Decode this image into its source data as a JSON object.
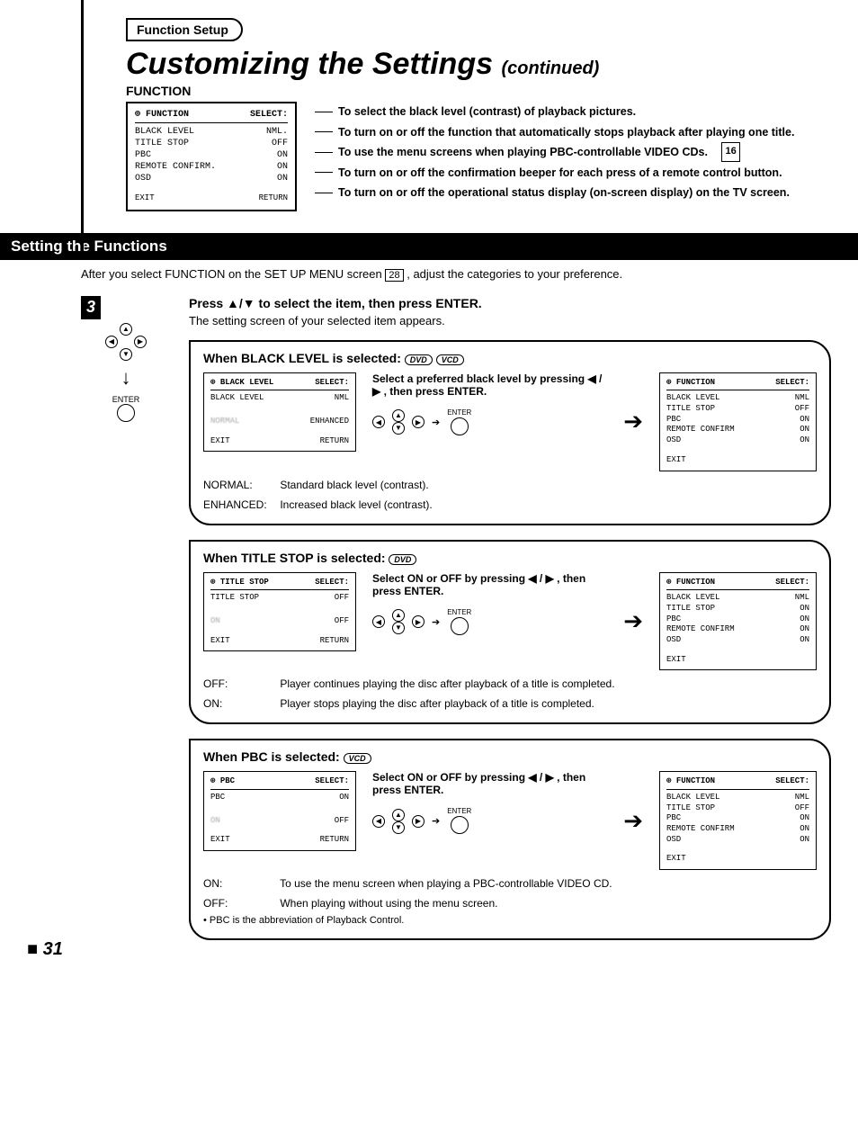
{
  "header": {
    "tab": "Function Setup",
    "title": "Customizing the Settings",
    "continued": "(continued)",
    "subhead": "FUNCTION"
  },
  "top_osd": {
    "title": "FUNCTION",
    "select": "SELECT:",
    "rows": [
      {
        "k": "BLACK LEVEL",
        "v": "NML."
      },
      {
        "k": "TITLE STOP",
        "v": "OFF"
      },
      {
        "k": "PBC",
        "v": "ON"
      },
      {
        "k": "REMOTE CONFIRM.",
        "v": "ON"
      },
      {
        "k": "OSD",
        "v": "ON"
      }
    ],
    "exit": "EXIT",
    "return": "RETURN"
  },
  "descriptions": [
    "To select the black level (contrast) of playback pictures.",
    "To turn on or off the function that automatically stops playback after playing one title.",
    "To use the menu screens when playing PBC-controllable VIDEO CDs.",
    "To turn on or off the confirmation beeper for each press of a remote control button.",
    "To turn on or off the operational status display (on-screen display) on the TV screen."
  ],
  "desc_ref": "16",
  "section_bar": "Setting the Functions",
  "intro_a": "After you select FUNCTION on the SET UP MENU screen ",
  "intro_ref": "28",
  "intro_b": " , adjust the categories to your preference.",
  "step": {
    "num": "3",
    "title": "Press ▲/▼ to select the item, then press ENTER.",
    "sub": "The setting screen of your selected item appears.",
    "enter_label": "ENTER"
  },
  "panels": [
    {
      "title": "When BLACK LEVEL is selected:",
      "badges": [
        "DVD",
        "VCD"
      ],
      "left_osd": {
        "title": "BLACK LEVEL",
        "select": "SELECT:",
        "rows": [
          {
            "k": "BLACK LEVEL",
            "v": "NML"
          }
        ],
        "opt1": "NORMAL",
        "opt2": "ENHANCED",
        "exit": "EXIT",
        "return": "RETURN"
      },
      "mid_text": "Select a preferred black level by pressing ◀ / ▶ , then press ENTER.",
      "enter_lbl": "ENTER",
      "result_osd": {
        "title": "FUNCTION",
        "select": "SELECT:",
        "rows": [
          {
            "k": "BLACK LEVEL",
            "v": "NML"
          },
          {
            "k": "TITLE STOP",
            "v": "OFF"
          },
          {
            "k": "PBC",
            "v": "ON"
          },
          {
            "k": "REMOTE CONFIRM",
            "v": "ON"
          },
          {
            "k": "OSD",
            "v": "ON"
          }
        ],
        "exit": "EXIT",
        "return": ""
      },
      "defs": [
        {
          "lbl": "NORMAL:",
          "txt": "Standard black level (contrast)."
        },
        {
          "lbl": "ENHANCED:",
          "txt": "Increased black level (contrast)."
        }
      ]
    },
    {
      "title": "When TITLE STOP is selected:",
      "badges": [
        "DVD"
      ],
      "left_osd": {
        "title": "TITLE STOP",
        "select": "SELECT:",
        "rows": [
          {
            "k": "TITLE STOP",
            "v": "OFF"
          }
        ],
        "opt1": "ON",
        "opt2": "OFF",
        "exit": "EXIT",
        "return": "RETURN"
      },
      "mid_text": "Select ON or OFF by pressing ◀ / ▶ , then press ENTER.",
      "enter_lbl": "ENTER",
      "result_osd": {
        "title": "FUNCTION",
        "select": "SELECT:",
        "rows": [
          {
            "k": "BLACK LEVEL",
            "v": "NML"
          },
          {
            "k": "TITLE STOP",
            "v": "ON"
          },
          {
            "k": "PBC",
            "v": "ON"
          },
          {
            "k": "REMOTE CONFIRM",
            "v": "ON"
          },
          {
            "k": "OSD",
            "v": "ON"
          }
        ],
        "exit": "EXIT",
        "return": ""
      },
      "defs": [
        {
          "lbl": "OFF:",
          "txt": "Player continues playing the disc after playback of a title is completed."
        },
        {
          "lbl": "ON:",
          "txt": "Player stops playing the disc after playback of a title is completed."
        }
      ]
    },
    {
      "title": "When PBC is selected:",
      "badges": [
        "VCD"
      ],
      "left_osd": {
        "title": "PBC",
        "select": "SELECT:",
        "rows": [
          {
            "k": "PBC",
            "v": "ON"
          }
        ],
        "opt1": "ON",
        "opt2": "OFF",
        "exit": "EXIT",
        "return": "RETURN"
      },
      "mid_text": "Select ON or OFF by pressing ◀ / ▶ , then press ENTER.",
      "enter_lbl": "ENTER",
      "result_osd": {
        "title": "FUNCTION",
        "select": "SELECT:",
        "rows": [
          {
            "k": "BLACK LEVEL",
            "v": "NML"
          },
          {
            "k": "TITLE STOP",
            "v": "OFF"
          },
          {
            "k": "PBC",
            "v": "ON"
          },
          {
            "k": "REMOTE CONFIRM",
            "v": "ON"
          },
          {
            "k": "OSD",
            "v": "ON"
          }
        ],
        "exit": "EXIT",
        "return": ""
      },
      "defs": [
        {
          "lbl": "ON:",
          "txt": "To use the menu screen when playing a PBC-controllable VIDEO CD."
        },
        {
          "lbl": "OFF:",
          "txt": "When playing without using the menu screen."
        }
      ],
      "bullet": "• PBC is the abbreviation of Playback Control."
    }
  ],
  "page_number": "31"
}
